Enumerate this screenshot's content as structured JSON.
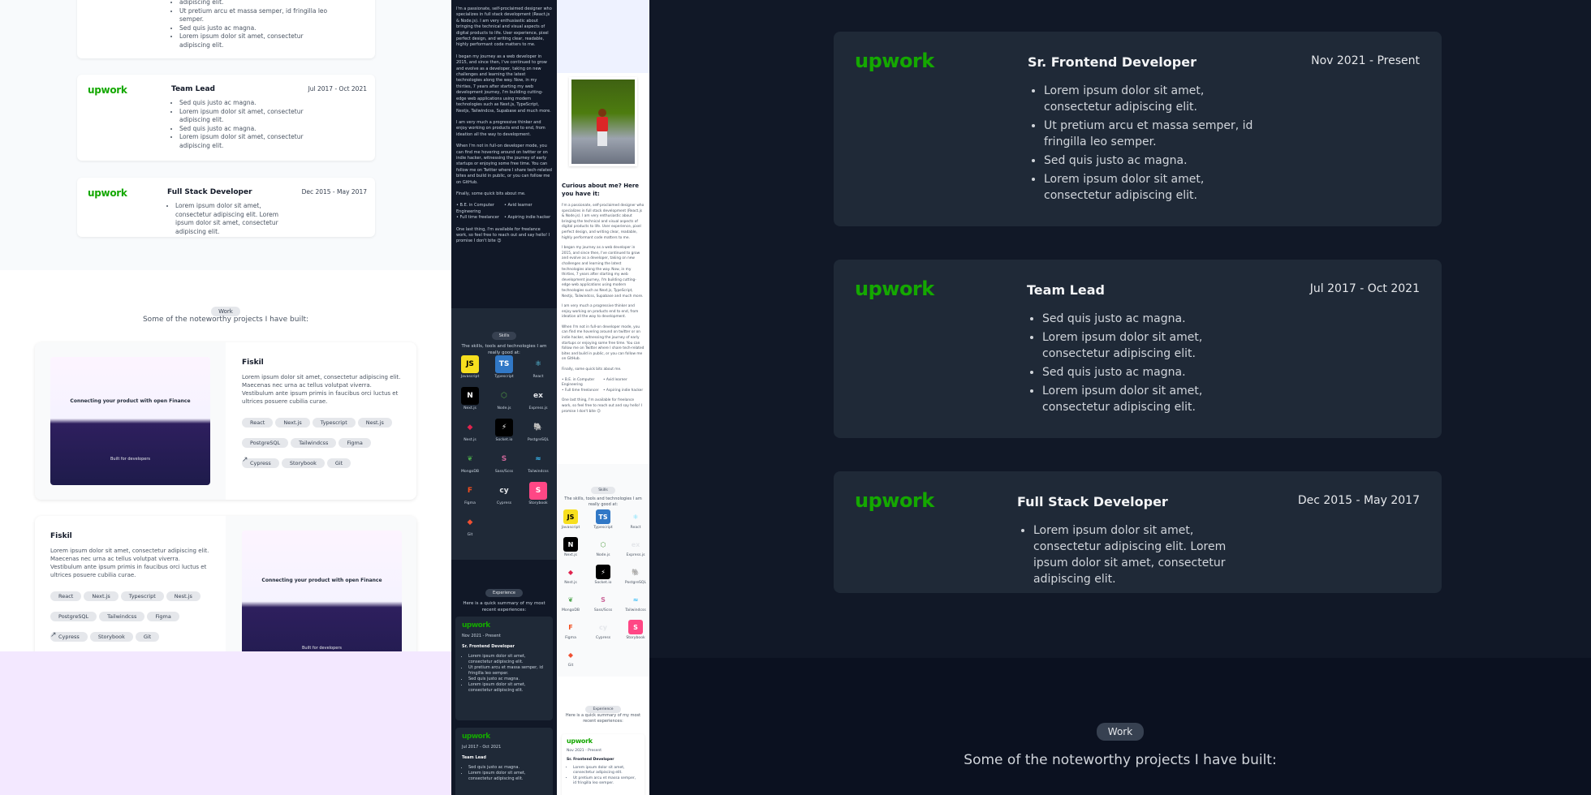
{
  "light": {
    "top_bullets": [
      "adipiscing elit.",
      "Ut pretium arcu et massa semper, id fringilla leo semper.",
      "Sed quis justo ac magna.",
      "Lorem ipsum dolor sit amet, consectetur adipiscing elit."
    ],
    "jobs": [
      {
        "logo": "upwork",
        "role": "Team Lead",
        "date": "Jul 2017 - Oct 2021",
        "bullets": [
          "Sed quis justo ac magna.",
          "Lorem ipsum dolor sit amet, consectetur adipiscing elit.",
          "Sed quis justo ac magna.",
          "Lorem ipsum dolor sit amet, consectetur adipiscing elit."
        ]
      },
      {
        "logo": "upwork",
        "role": "Full Stack Developer",
        "date": "Dec 2015 - May 2017",
        "bullets": [
          "Lorem ipsum dolor sit amet, consectetur adipiscing elit. Lorem ipsum dolor sit amet, consectetur adipiscing elit."
        ]
      }
    ],
    "work_badge": "Work",
    "work_subtitle": "Some of the noteworthy projects I have built:",
    "projects": [
      {
        "name": "Fiskil",
        "desc": "Lorem ipsum dolor sit amet, consectetur adipiscing elit. Maecenas nec urna ac tellus volutpat viverra. Vestibulum ante ipsum primis in faucibus orci luctus et ultrices posuere cubilia curae.",
        "tags": [
          "React",
          "Next.js",
          "Typescript",
          "Nest.js",
          "PostgreSQL",
          "Tailwindcss",
          "Figma",
          "Cypress",
          "Storybook",
          "Git"
        ],
        "hero": "Connecting your product with open Finance",
        "sub": "Built for developers"
      },
      {
        "name": "Fiskil",
        "desc": "Lorem ipsum dolor sit amet, consectetur adipiscing elit. Maecenas nec urna ac tellus volutpat viverra. Vestibulum ante ipsum primis in faucibus orci luctus et ultrices posuere cubilia curae.",
        "tags": [
          "React",
          "Next.js",
          "Typescript",
          "Nest.js",
          "PostgreSQL",
          "Tailwindcss",
          "Figma",
          "Cypress",
          "Storybook",
          "Git"
        ],
        "hero": "Connecting your product with open Finance",
        "sub": "Built for developers"
      }
    ]
  },
  "mobile": {
    "about_title": "Curious about me? Here you have it:",
    "para1": "I'm a passionate, self-proclaimed designer who specializes in full stack development (React.js & Node.js). I am very enthusiastic about bringing the technical and visual aspects of digital products to life. User experience, pixel perfect design, and writing clear, readable, highly performant code matters to me.",
    "para2": "I began my journey as a web developer in 2015, and since then, I've continued to grow and evolve as a developer, taking on new challenges and learning the latest technologies along the way. Now, in my thirties, 7 years after starting my web development journey, I'm building cutting-edge web applications using modern technologies such as Next.js, TypeScript, Nestjs, Tailwindcss, Supabase and much more.",
    "para3": "I am very much a progressive thinker and enjoy working on products end to end, from ideation all the way to development.",
    "para4": "When I'm not in full-on developer mode, you can find me hovering around on twitter or on indie hacker, witnessing the journey of early startups or enjoying some free time. You can follow me on Twitter where I share tech-related bites and build in public, or you can follow me on GitHub.",
    "para5": "Finally, some quick bits about me.",
    "bits": [
      "B.E. in Computer Engineering",
      "Full time freelancer",
      "Avid learner",
      "Aspiring indie hacker"
    ],
    "para6": "One last thing, I'm available for freelance work, so feel free to reach out and say hello! I promise I don't bite 😉",
    "skills_badge": "Skills",
    "skills_subtitle": "The skills, tools and technologies I am really good at:",
    "skills": [
      "Javascript",
      "Typescript",
      "React",
      "Next.js",
      "Node.js",
      "Express.js",
      "Nest.js",
      "Socket.io",
      "PostgreSQL",
      "MongoDB",
      "Sass/Scss",
      "Tailwindcss",
      "Figma",
      "Cypress",
      "Storybook",
      "Git"
    ],
    "exp_badge": "Experience",
    "exp_subtitle": "Here is a quick summary of my most recent experiences:",
    "exp": [
      {
        "logo": "upwork",
        "date": "Nov 2021 - Present",
        "role": "Sr. Frontend Developer",
        "bullets": [
          "Lorem ipsum dolor sit amet, consectetur adipiscing elit.",
          "Ut pretium arcu et massa semper, id fringilla leo semper.",
          "Sed quis justo ac magna.",
          "Lorem ipsum dolor sit amet, consectetur adipiscing elit."
        ]
      },
      {
        "logo": "upwork",
        "date": "Jul 2017 - Oct 2021",
        "role": "Team Lead",
        "bullets": [
          "Sed quis justo ac magna.",
          "Lorem ipsum dolor sit amet, consectetur adipiscing elit."
        ]
      }
    ]
  },
  "dark": {
    "jobs": [
      {
        "logo": "upwork",
        "role": "Sr. Frontend Developer",
        "date": "Nov 2021 - Present",
        "bullets": [
          "Lorem ipsum dolor sit amet, consectetur adipiscing elit.",
          "Ut pretium arcu et massa semper, id fringilla leo semper.",
          "Sed quis justo ac magna.",
          "Lorem ipsum dolor sit amet, consectetur adipiscing elit."
        ]
      },
      {
        "logo": "upwork",
        "role": "Team Lead",
        "date": "Jul 2017 - Oct 2021",
        "bullets": [
          "Sed quis justo ac magna.",
          "Lorem ipsum dolor sit amet, consectetur adipiscing elit.",
          "Sed quis justo ac magna.",
          "Lorem ipsum dolor sit amet, consectetur adipiscing elit."
        ]
      },
      {
        "logo": "upwork",
        "role": "Full Stack Developer",
        "date": "Dec 2015 - May 2017",
        "bullets": [
          "Lorem ipsum dolor sit amet, consectetur adipiscing elit. Lorem ipsum dolor sit amet, consectetur adipiscing elit."
        ]
      }
    ],
    "work_badge": "Work",
    "work_subtitle": "Some of the noteworthy projects I have built:"
  },
  "colors": {
    "upwork": "#14a800",
    "dark_bg": "#111827",
    "dark_card": "#1f2937",
    "light_lower": "#f3e8ff"
  }
}
